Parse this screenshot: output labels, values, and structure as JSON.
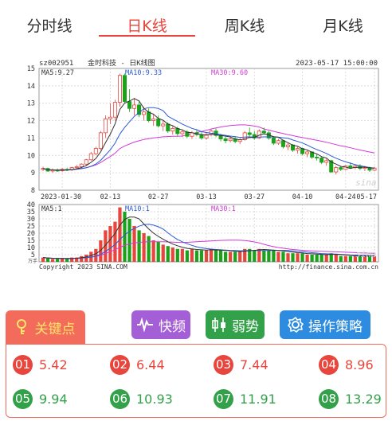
{
  "tabs": [
    {
      "label": "分时线",
      "active": false
    },
    {
      "label": "日K线",
      "active": true
    },
    {
      "label": "周K线",
      "active": false
    },
    {
      "label": "月K线",
      "active": false
    }
  ],
  "chart": {
    "code": "sz002951",
    "title": "金时科技 - 日K线图",
    "datetime": "2023-05-17 15:00:00",
    "ma5_label": "MA5:9.27",
    "ma10_label": "MA10:9.33",
    "ma30_label": "MA30:9.60",
    "vol_ma5_label": "MA5:1",
    "vol_ma10_label": "MA10:1",
    "vol_ma30_label": "MA30:1",
    "vol_unit": "万手",
    "copyright": "Copyright 2023 SINA.COM",
    "source_url": "http://finance.sina.com.cn",
    "watermark": "sina",
    "price_ticks": [
      "15",
      "14",
      "13",
      "12",
      "11",
      "10",
      "9",
      "8"
    ],
    "vol_ticks": [
      "40",
      "35",
      "30",
      "25",
      "20",
      "15",
      "10",
      "5"
    ],
    "date_ticks": [
      "2023-01-30",
      "02-13",
      "02-27",
      "03-13",
      "03-27",
      "04-10",
      "04-24",
      "05-17"
    ],
    "colors": {
      "up": "#e8453c",
      "down": "#1aa21a",
      "ma5": "#333333",
      "ma10": "#2a5bd7",
      "ma30": "#d23ad8"
    }
  },
  "chart_data": {
    "type": "candlestick",
    "price_ylim": [
      8,
      15
    ],
    "volume_ylim": [
      0,
      40
    ],
    "candles": [
      [
        9.2,
        9.35,
        9.1,
        9.25,
        3
      ],
      [
        9.25,
        9.3,
        9.05,
        9.1,
        2.5
      ],
      [
        9.1,
        9.25,
        9.0,
        9.15,
        2
      ],
      [
        9.15,
        9.25,
        9.05,
        9.12,
        2
      ],
      [
        9.12,
        9.28,
        9.05,
        9.2,
        2.5
      ],
      [
        9.2,
        9.3,
        9.1,
        9.18,
        2
      ],
      [
        9.18,
        9.35,
        9.1,
        9.3,
        3
      ],
      [
        9.3,
        9.45,
        9.2,
        9.35,
        3
      ],
      [
        9.35,
        9.55,
        9.25,
        9.5,
        4
      ],
      [
        9.5,
        9.8,
        9.4,
        9.75,
        5
      ],
      [
        9.75,
        10.2,
        9.7,
        10.1,
        7
      ],
      [
        10.1,
        10.5,
        10.0,
        10.4,
        9
      ],
      [
        10.4,
        11.4,
        10.3,
        11.3,
        15
      ],
      [
        11.3,
        12.3,
        11.0,
        12.1,
        22
      ],
      [
        12.1,
        13.0,
        11.8,
        12.2,
        25
      ],
      [
        12.2,
        13.2,
        12.0,
        13.05,
        28
      ],
      [
        13.05,
        14.7,
        12.8,
        14.6,
        38
      ],
      [
        14.6,
        14.7,
        13.0,
        13.1,
        35
      ],
      [
        13.1,
        13.8,
        12.5,
        12.7,
        30
      ],
      [
        12.7,
        13.3,
        12.3,
        12.9,
        25
      ],
      [
        12.9,
        13.1,
        12.2,
        12.35,
        22
      ],
      [
        12.35,
        12.8,
        12.0,
        12.5,
        20
      ],
      [
        12.5,
        12.7,
        11.9,
        12.0,
        18
      ],
      [
        12.0,
        12.4,
        11.7,
        12.1,
        15
      ],
      [
        12.1,
        12.3,
        11.6,
        11.7,
        14
      ],
      [
        11.7,
        12.0,
        11.4,
        11.8,
        12
      ],
      [
        11.8,
        11.9,
        11.3,
        11.4,
        11
      ],
      [
        11.4,
        11.7,
        11.2,
        11.55,
        10
      ],
      [
        11.55,
        11.65,
        11.1,
        11.25,
        9
      ],
      [
        11.25,
        11.5,
        11.05,
        11.35,
        9
      ],
      [
        11.35,
        11.45,
        11.0,
        11.1,
        8
      ],
      [
        11.1,
        11.4,
        10.95,
        11.3,
        9
      ],
      [
        11.3,
        11.5,
        11.1,
        11.2,
        8
      ],
      [
        11.2,
        11.35,
        10.9,
        11.0,
        8
      ],
      [
        11.0,
        11.3,
        10.9,
        11.2,
        8
      ],
      [
        11.2,
        11.5,
        11.1,
        11.4,
        9
      ],
      [
        11.4,
        11.55,
        11.05,
        11.15,
        8
      ],
      [
        11.15,
        11.25,
        10.8,
        10.95,
        8
      ],
      [
        10.95,
        11.1,
        10.7,
        10.85,
        7
      ],
      [
        10.85,
        11.05,
        10.75,
        10.95,
        7
      ],
      [
        10.95,
        11.1,
        10.7,
        10.8,
        7
      ],
      [
        10.8,
        11.0,
        10.65,
        10.9,
        7
      ],
      [
        10.9,
        11.4,
        10.85,
        11.3,
        9
      ],
      [
        11.3,
        11.6,
        11.1,
        11.2,
        9
      ],
      [
        11.2,
        11.4,
        10.9,
        11.0,
        8
      ],
      [
        11.0,
        11.5,
        10.95,
        11.4,
        9
      ],
      [
        11.4,
        11.6,
        11.2,
        11.3,
        8
      ],
      [
        11.3,
        11.4,
        10.9,
        11.0,
        8
      ],
      [
        11.0,
        11.1,
        10.6,
        10.7,
        8
      ],
      [
        10.7,
        10.95,
        10.6,
        10.85,
        7
      ],
      [
        10.85,
        10.9,
        10.4,
        10.5,
        7
      ],
      [
        10.5,
        10.7,
        10.3,
        10.6,
        6
      ],
      [
        10.6,
        10.65,
        10.2,
        10.3,
        6
      ],
      [
        10.3,
        10.5,
        10.1,
        10.4,
        6
      ],
      [
        10.4,
        10.45,
        10.0,
        10.1,
        6
      ],
      [
        10.1,
        10.3,
        9.9,
        10.2,
        5
      ],
      [
        10.2,
        10.25,
        9.8,
        9.9,
        5
      ],
      [
        9.9,
        10.1,
        9.7,
        9.85,
        5
      ],
      [
        9.85,
        9.95,
        9.5,
        9.6,
        5
      ],
      [
        9.6,
        9.8,
        9.4,
        9.7,
        5
      ],
      [
        9.7,
        9.75,
        9.0,
        9.05,
        6
      ],
      [
        9.05,
        9.4,
        8.9,
        9.3,
        5
      ],
      [
        9.3,
        9.4,
        9.1,
        9.2,
        4
      ],
      [
        9.2,
        9.45,
        9.15,
        9.4,
        4
      ],
      [
        9.4,
        9.6,
        9.25,
        9.3,
        4
      ],
      [
        9.3,
        9.5,
        9.2,
        9.4,
        4
      ],
      [
        9.4,
        9.5,
        9.15,
        9.25,
        4
      ],
      [
        9.25,
        9.4,
        9.1,
        9.3,
        4
      ],
      [
        9.3,
        9.35,
        9.05,
        9.15,
        4
      ],
      [
        9.15,
        9.35,
        9.1,
        9.27,
        4
      ]
    ]
  },
  "toolbar": {
    "key_label": "关键点",
    "fast_label": "快频",
    "weak_label": "弱势",
    "strategy_label": "操作策略"
  },
  "keypoints": [
    {
      "num": "01",
      "value": "5.42",
      "color": "#e8453c"
    },
    {
      "num": "02",
      "value": "6.44",
      "color": "#e8453c"
    },
    {
      "num": "03",
      "value": "7.44",
      "color": "#e8453c"
    },
    {
      "num": "04",
      "value": "8.96",
      "color": "#e8453c"
    },
    {
      "num": "05",
      "value": "9.94",
      "color": "#33a04a"
    },
    {
      "num": "06",
      "value": "10.93",
      "color": "#33a04a"
    },
    {
      "num": "07",
      "value": "11.91",
      "color": "#33a04a"
    },
    {
      "num": "08",
      "value": "13.29",
      "color": "#33a04a"
    }
  ]
}
